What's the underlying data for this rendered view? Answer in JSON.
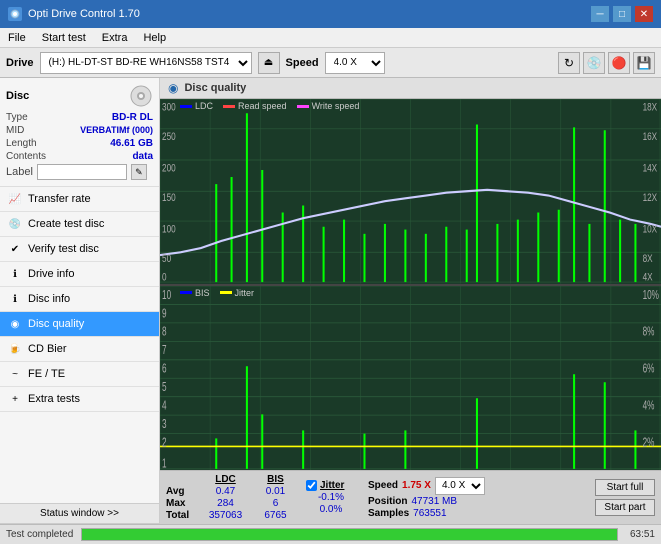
{
  "titlebar": {
    "title": "Opti Drive Control 1.70",
    "minimize": "─",
    "maximize": "□",
    "close": "✕"
  },
  "menubar": {
    "items": [
      "File",
      "Start test",
      "Extra",
      "Help"
    ]
  },
  "drivebar": {
    "label": "Drive",
    "drive_value": "(H:)  HL-DT-ST BD-RE  WH16NS58 TST4",
    "speed_label": "Speed",
    "speed_value": "4.0 X"
  },
  "disc": {
    "title": "Disc",
    "type_label": "Type",
    "type_value": "BD-R DL",
    "mid_label": "MID",
    "mid_value": "VERBATIMf (000)",
    "length_label": "Length",
    "length_value": "46.61 GB",
    "contents_label": "Contents",
    "contents_value": "data",
    "label_label": "Label",
    "label_value": ""
  },
  "nav": {
    "items": [
      {
        "id": "transfer-rate",
        "label": "Transfer rate"
      },
      {
        "id": "create-test-disc",
        "label": "Create test disc"
      },
      {
        "id": "verify-test-disc",
        "label": "Verify test disc"
      },
      {
        "id": "drive-info",
        "label": "Drive info"
      },
      {
        "id": "disc-info",
        "label": "Disc info"
      },
      {
        "id": "disc-quality",
        "label": "Disc quality",
        "active": true
      },
      {
        "id": "cd-bier",
        "label": "CD Bier"
      },
      {
        "id": "fe-te",
        "label": "FE / TE"
      },
      {
        "id": "extra-tests",
        "label": "Extra tests"
      }
    ]
  },
  "chart": {
    "title": "Disc quality",
    "legend_top": [
      "LDC",
      "Read speed",
      "Write speed"
    ],
    "legend_bottom": [
      "BIS",
      "Jitter"
    ],
    "top_y_left_max": 300,
    "top_y_right_max": 18,
    "top_y_right_unit": "X",
    "bottom_y_left_max": 10,
    "bottom_y_right_max": 10,
    "bottom_y_right_unit": "%",
    "x_max": 50,
    "x_unit": "GB"
  },
  "stats": {
    "col_ldc": "LDC",
    "col_bis": "BIS",
    "col_jitter": "Jitter",
    "col_speed": "Speed",
    "col_position": "Position",
    "row_avg": "Avg",
    "row_max": "Max",
    "row_total": "Total",
    "avg_ldc": "0.47",
    "avg_bis": "0.01",
    "avg_jitter": "-0.1%",
    "max_ldc": "284",
    "max_bis": "6",
    "max_jitter": "0.0%",
    "total_ldc": "357063",
    "total_bis": "6765",
    "speed_value": "1.75 X",
    "position_value": "47731 MB",
    "samples_value": "763551",
    "speed_label": "Speed",
    "position_label": "Position",
    "samples_label": "Samples",
    "jitter_checked": true,
    "speed_select": "4.0 X",
    "start_full_label": "Start full",
    "start_part_label": "Start part"
  },
  "statusbar": {
    "status_window_label": "Status window >>",
    "status_text": "Test completed",
    "progress_percent": 100,
    "time": "63:51"
  }
}
